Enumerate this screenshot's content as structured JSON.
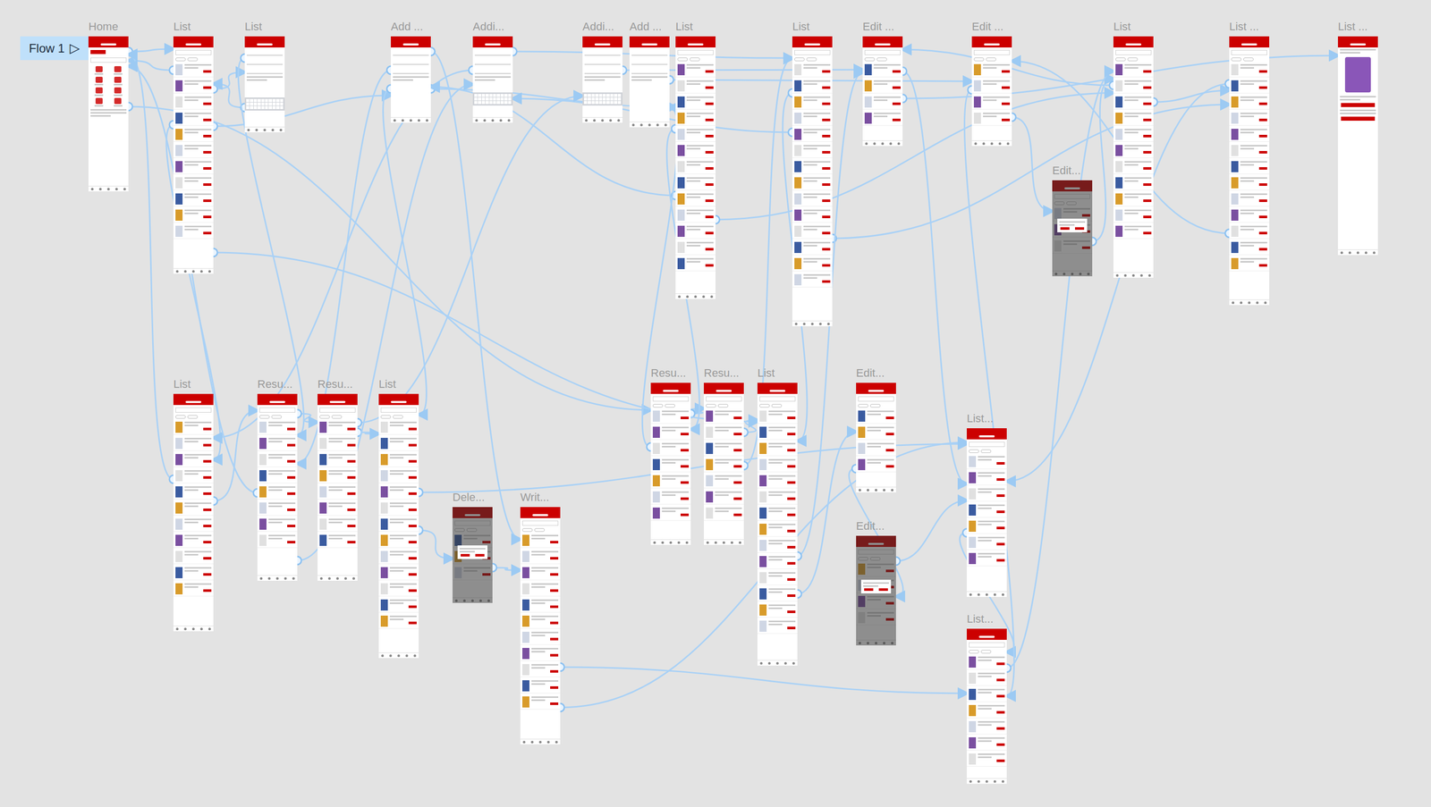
{
  "canvas": {
    "flow": {
      "label": "Flow 1",
      "icon": "▷"
    }
  },
  "frames": [
    {
      "label": "Home",
      "kind": "home"
    },
    {
      "label": "List",
      "kind": "list"
    },
    {
      "label": "List",
      "kind": "keyboard"
    },
    {
      "label": "Add ...",
      "kind": "form"
    },
    {
      "label": "Addi...",
      "kind": "keyboard"
    },
    {
      "label": "Addi...",
      "kind": "keyboard"
    },
    {
      "label": "Add ...",
      "kind": "form"
    },
    {
      "label": "List",
      "kind": "list"
    },
    {
      "label": "List",
      "kind": "list"
    },
    {
      "label": "Edit ...",
      "kind": "list"
    },
    {
      "label": "Edit ...",
      "kind": "list"
    },
    {
      "label": "Edit...",
      "kind": "dialog"
    },
    {
      "label": "List",
      "kind": "list"
    },
    {
      "label": "List ...",
      "kind": "list"
    },
    {
      "label": "List ...",
      "kind": "detail"
    },
    {
      "label": "List",
      "kind": "list"
    },
    {
      "label": "Resu...",
      "kind": "list"
    },
    {
      "label": "Resu...",
      "kind": "list"
    },
    {
      "label": "List",
      "kind": "list"
    },
    {
      "label": "Dele...",
      "kind": "dialog"
    },
    {
      "label": "Writ...",
      "kind": "list"
    },
    {
      "label": "Resu...",
      "kind": "list"
    },
    {
      "label": "Resu...",
      "kind": "list"
    },
    {
      "label": "List",
      "kind": "list"
    },
    {
      "label": "Edit...",
      "kind": "list"
    },
    {
      "label": "Edit...",
      "kind": "dialog"
    },
    {
      "label": "List...",
      "kind": "list"
    },
    {
      "label": "List...",
      "kind": "list"
    }
  ]
}
